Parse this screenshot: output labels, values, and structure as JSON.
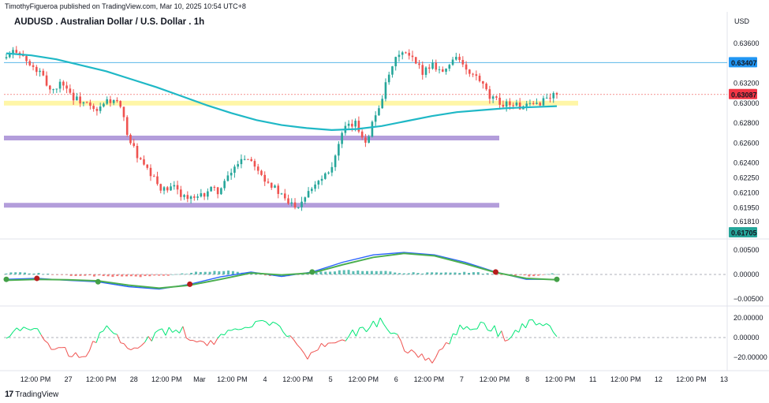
{
  "attribution": "TimothyFigueroa published on TradingView.com, Mar 10, 2025 10:54 UTC+8",
  "chart_title": "AUDUSD . Australian Dollar / U.S. Dollar . 1h",
  "currency": "USD",
  "logo_text": "TradingView",
  "colors": {
    "bull": "#26a69a",
    "bear": "#ef5350",
    "ema": "#1fb8c6",
    "resistance_line": "#5bb8e8",
    "yellow_zone": "#fff59d",
    "purple_zone": "#b39ddb",
    "macd_line": "#2962ff",
    "signal_line": "#4caf50",
    "rsi_bull": "#00e676",
    "rsi_bear": "#ef5350"
  },
  "chart_data": {
    "type": "candlestick",
    "price_axis": {
      "ticks": [
        "0.63600",
        "0.63200",
        "0.63000",
        "0.62800",
        "0.62600",
        "0.62400",
        "0.62250",
        "0.62100",
        "0.61950",
        "0.61810"
      ],
      "current_price_label": "0.63087",
      "level_label": "0.63407",
      "low_label": "0.61705"
    },
    "macd_axis": {
      "ticks": [
        "0.00500",
        "0.00000",
        "−0.00500"
      ]
    },
    "rsi_axis": {
      "ticks": [
        "20.00000",
        "0.00000",
        "−20.00000"
      ]
    },
    "time_axis": {
      "labels": [
        "12:00 PM",
        "27",
        "12:00 PM",
        "28",
        "12:00 PM",
        "Mar",
        "12:00 PM",
        "4",
        "12:00 PM",
        "5",
        "12:00 PM",
        "6",
        "12:00 PM",
        "7",
        "12:00 PM",
        "8",
        "12:00 PM",
        "11",
        "12:00 PM",
        "12",
        "12:00 PM",
        "13"
      ]
    },
    "close_path": [
      0.6345,
      0.6355,
      0.6338,
      0.633,
      0.6312,
      0.6322,
      0.6305,
      0.63,
      0.629,
      0.6303,
      0.63,
      0.6262,
      0.624,
      0.6225,
      0.6212,
      0.6215,
      0.6205,
      0.6203,
      0.6213,
      0.6212,
      0.623,
      0.6247,
      0.6242,
      0.6225,
      0.6213,
      0.62,
      0.6198,
      0.6215,
      0.6225,
      0.6238,
      0.6272,
      0.628,
      0.6262,
      0.6292,
      0.6325,
      0.6352,
      0.6345,
      0.6332,
      0.634,
      0.633,
      0.635,
      0.633,
      0.6325,
      0.6305,
      0.63,
      0.63,
      0.6295,
      0.6298,
      0.6305,
      0.6309
    ],
    "ema_path": [
      0.635,
      0.6348,
      0.6344,
      0.6338,
      0.6332,
      0.6324,
      0.6316,
      0.6307,
      0.6298,
      0.629,
      0.6283,
      0.6278,
      0.6275,
      0.6273,
      0.6274,
      0.6277,
      0.6282,
      0.6287,
      0.6291,
      0.6293,
      0.6295,
      0.6296,
      0.6297
    ],
    "levels": {
      "resistance": 0.63407,
      "zone_yellow": 0.63,
      "zone_purple_upper": 0.6265,
      "zone_purple_lower": 0.61975
    },
    "macd_line": [
      -0.001,
      -0.0008,
      -0.0012,
      -0.0015,
      -0.0025,
      -0.003,
      -0.002,
      -0.0005,
      0.0005,
      -0.0004,
      0.0005,
      0.0025,
      0.004,
      0.0045,
      0.004,
      0.0025,
      0.0005,
      -0.001,
      -0.001
    ],
    "signal_line": [
      -0.0012,
      -0.001,
      -0.0011,
      -0.0013,
      -0.0022,
      -0.0028,
      -0.0022,
      -0.001,
      0.0003,
      -0.0001,
      0.0003,
      0.002,
      0.0035,
      0.0043,
      0.0038,
      0.0022,
      0.0004,
      -0.0008,
      -0.0011
    ],
    "rsi": [
      2,
      12,
      -12,
      -20,
      10,
      -15,
      3,
      8,
      -10,
      5,
      18,
      12,
      -18,
      -5,
      6,
      18,
      -12,
      -25,
      8,
      15,
      0,
      15,
      5
    ],
    "macd_dots": [
      0,
      1,
      3,
      6,
      10,
      16,
      18
    ]
  }
}
